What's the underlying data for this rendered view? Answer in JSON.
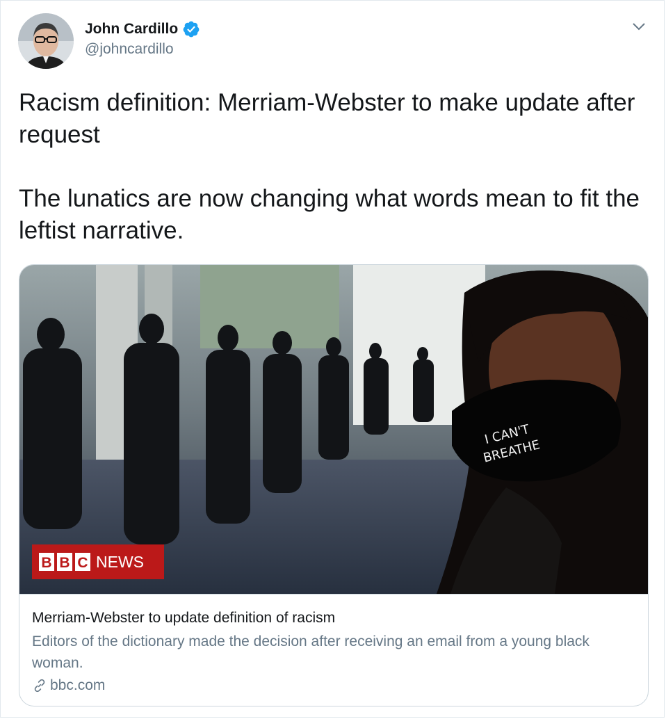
{
  "author": {
    "name": "John Cardillo",
    "handle": "@johncardillo",
    "verified": true,
    "avatar_icon": "profile-photo"
  },
  "tweet": {
    "text": "Racism definition: Merriam-Webster to make update after request\n\nThe lunatics are now changing what words mean to fit the leftist narrative."
  },
  "card": {
    "image_logo_text": [
      "B",
      "B",
      "C",
      "NEWS"
    ],
    "mask_text": [
      "I CAN'T",
      "BREATHE"
    ],
    "title": "Merriam-Webster to update definition of racism",
    "description": "Editors of the dictionary made the decision after receiving an email from a young black woman.",
    "domain": "bbc.com"
  },
  "colors": {
    "text": "#14171a",
    "secondary": "#657786",
    "verified_blue": "#1da1f2",
    "border": "#ccd6dd",
    "bbc_red": "#bb1919"
  }
}
